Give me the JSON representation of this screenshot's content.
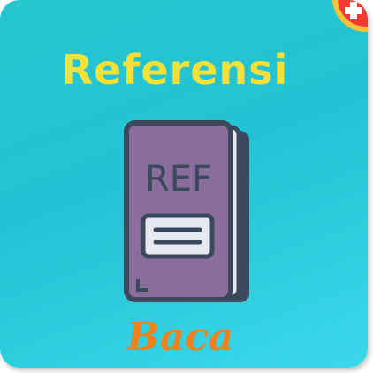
{
  "card": {
    "title": "Referensi",
    "action_label": "Baca"
  },
  "book_icon": {
    "icon": "book-icon",
    "cover_text": "REF",
    "cover_color": "#8a6d9c",
    "outline_color": "#3a4a5c",
    "pages_color": "#e6e9f0"
  },
  "badge": {
    "icon": "plus-icon",
    "color": "#ef3b32",
    "ring_color": "#f6c23a"
  },
  "colors": {
    "background": "#26c6cf",
    "title": "#f6e03a",
    "action": "#f0821e"
  }
}
